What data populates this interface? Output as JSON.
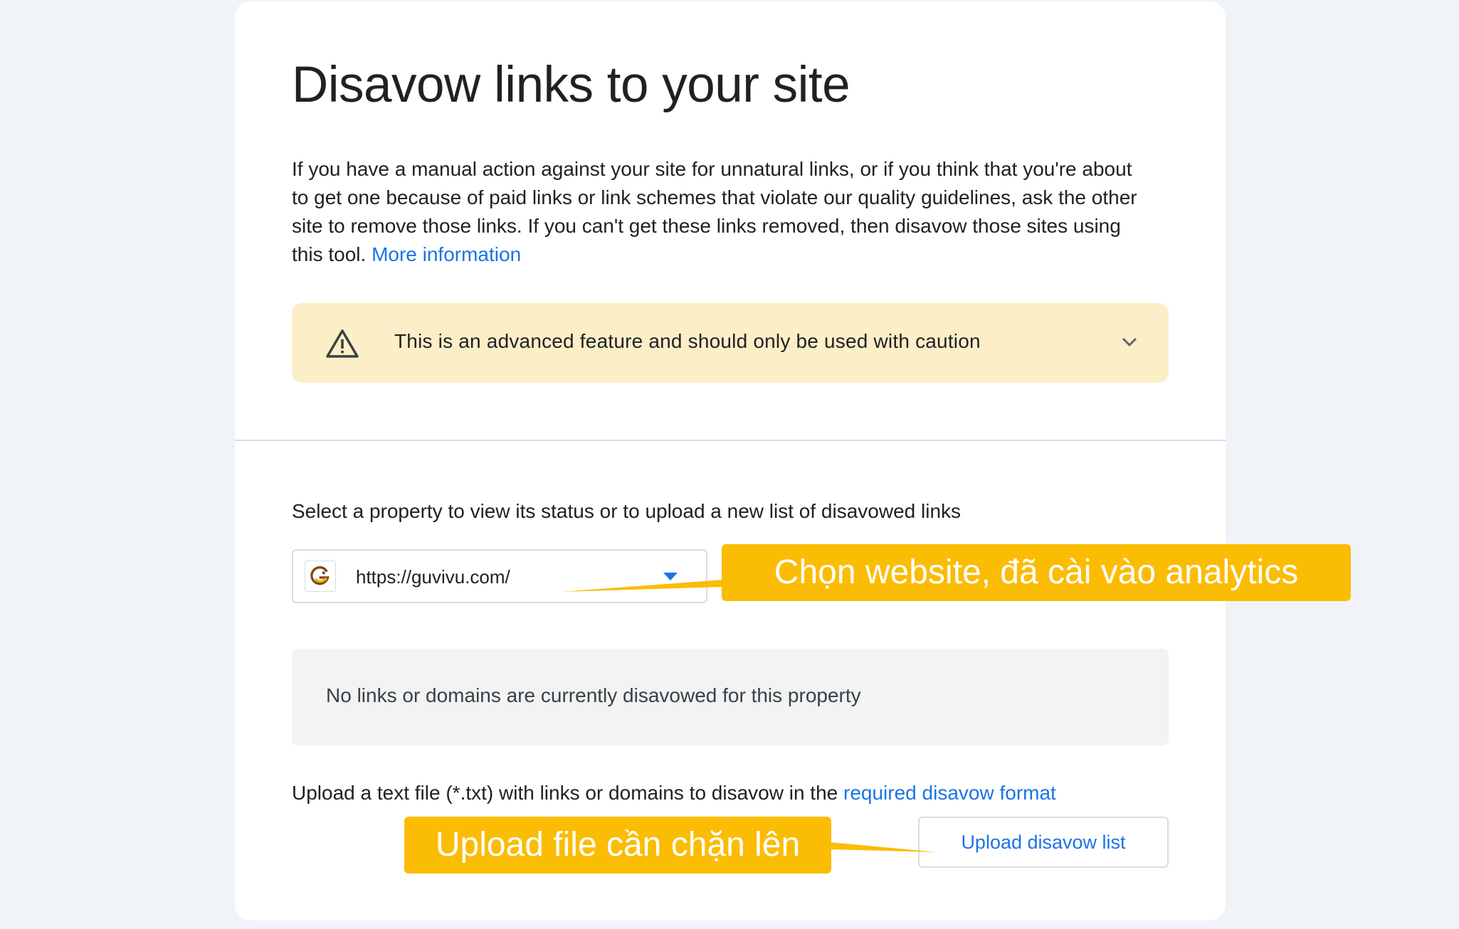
{
  "page": {
    "title": "Disavow links to your site",
    "intro_text": "If you have a manual action against your site for unnatural links, or if you think that you're about to get one because of paid links or link schemes that violate our quality guidelines, ask the other site to remove those links. If you can't get these links removed, then disavow those sites using this tool.",
    "intro_link": "More information"
  },
  "warning": {
    "icon": "warning-triangle-icon",
    "text": "This is an advanced feature and should only be used with caution",
    "expand_icon": "chevron-down-icon",
    "background": "#fcefc7"
  },
  "property": {
    "label": "Select a property to view its status or to upload a new list of disavowed links",
    "selected": "https://guvivu.com/",
    "favicon": "site-favicon",
    "dropdown_icon": "dropdown-arrow-icon"
  },
  "status": {
    "text": "No links or domains are currently disavowed for this property"
  },
  "upload": {
    "info_text": "Upload a text file (*.txt) with links or domains to disavow in the",
    "info_link": "required disavow format",
    "button_label": "Upload disavow list"
  },
  "annotations": {
    "select_callout": "Chọn website, đã cài vào analytics",
    "upload_callout": "Upload file cần chặn lên",
    "color": "#fbbc04"
  },
  "colors": {
    "link": "#1a73e8",
    "background": "#f0f3f8",
    "card": "#ffffff"
  }
}
